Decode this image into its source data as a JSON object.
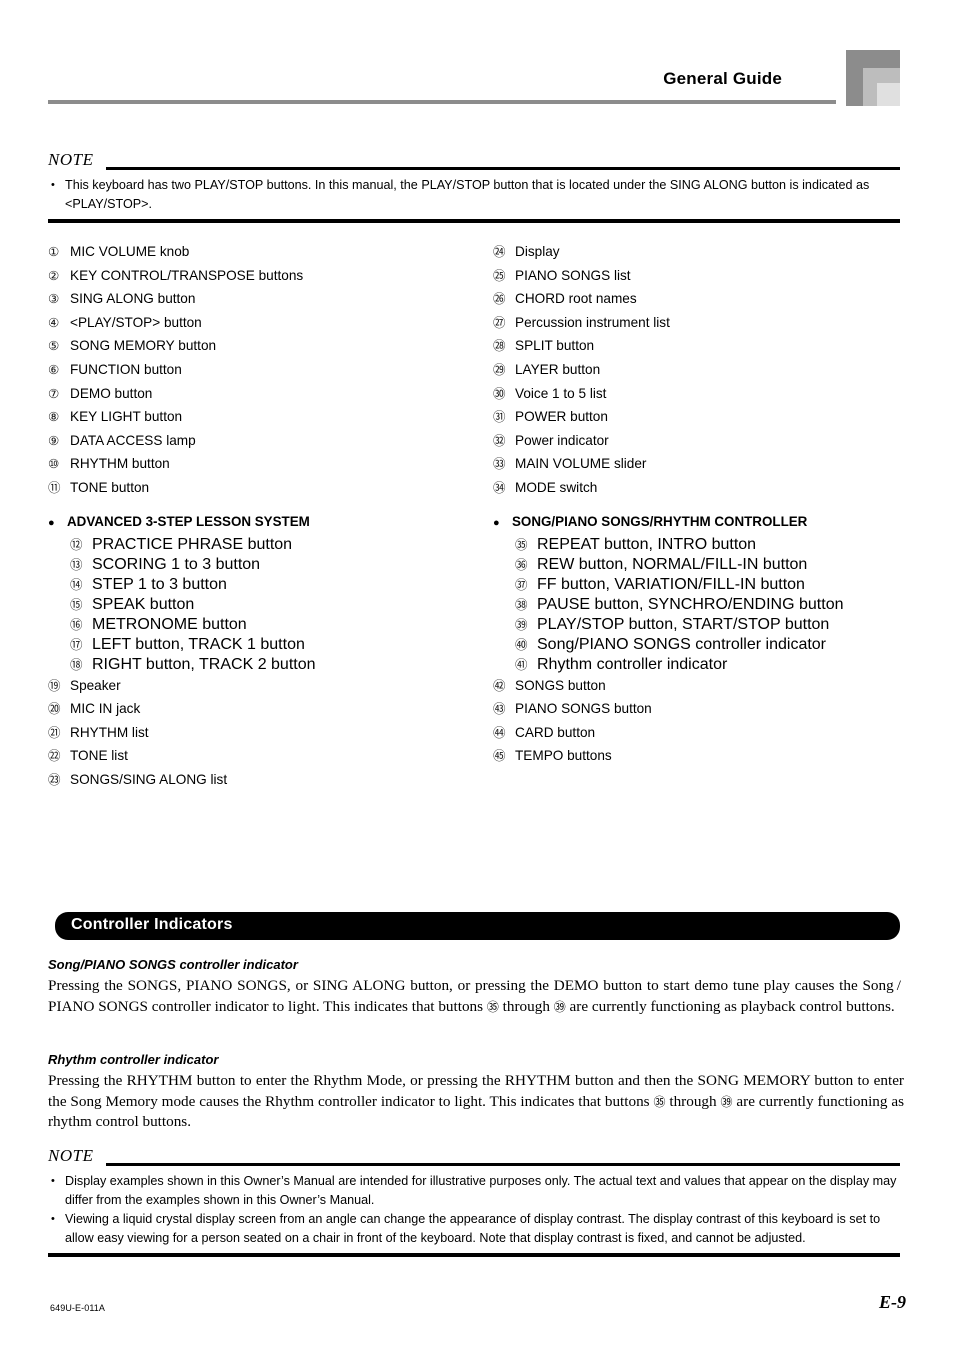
{
  "header": {
    "title": "General Guide",
    "corner_colors": [
      "#8c8c8c",
      "#bdbdbd",
      "#e0e0e0"
    ],
    "rule_color": "#8c8c8c"
  },
  "top_note": {
    "label": "NOTE",
    "items": [
      "This keyboard has two PLAY/STOP buttons. In this manual, the PLAY/STOP button that is located under the SING ALONG button is indicated as <PLAY/STOP>."
    ]
  },
  "reference_list": {
    "left_column": {
      "items_before": [
        {
          "num": "①",
          "text": "MIC VOLUME knob"
        },
        {
          "num": "②",
          "text": "KEY CONTROL/TRANSPOSE buttons"
        },
        {
          "num": "③",
          "text": "SING ALONG button"
        },
        {
          "num": "④",
          "text": "<PLAY/STOP> button"
        },
        {
          "num": "⑤",
          "text": "SONG MEMORY button"
        },
        {
          "num": "⑥",
          "text": "FUNCTION button"
        },
        {
          "num": "⑦",
          "text": "DEMO button"
        },
        {
          "num": "⑧",
          "text": "KEY LIGHT button"
        },
        {
          "num": "⑨",
          "text": "DATA ACCESS lamp"
        },
        {
          "num": "⑩",
          "text": "RHYTHM button"
        },
        {
          "num": "⑪",
          "text": "TONE button"
        }
      ],
      "group": {
        "bullet": "●",
        "title": "ADVANCED 3-STEP LESSON SYSTEM",
        "items": [
          {
            "num": "⑫",
            "text": "PRACTICE PHRASE button"
          },
          {
            "num": "⑬",
            "text": "SCORING 1 to 3 button"
          },
          {
            "num": "⑭",
            "text": "STEP 1 to 3 button"
          },
          {
            "num": "⑮",
            "text": "SPEAK button"
          },
          {
            "num": "⑯",
            "text": "METRONOME button"
          },
          {
            "num": "⑰",
            "text": "LEFT button, TRACK 1 button"
          },
          {
            "num": "⑱",
            "text": "RIGHT button, TRACK 2 button"
          }
        ]
      },
      "items_after": [
        {
          "num": "⑲",
          "text": "Speaker"
        },
        {
          "num": "⑳",
          "text": "MIC IN jack"
        },
        {
          "num": "㉑",
          "text": "RHYTHM list"
        },
        {
          "num": "㉒",
          "text": "TONE list"
        },
        {
          "num": "㉓",
          "text": "SONGS/SING ALONG list"
        }
      ]
    },
    "right_column": {
      "items_before": [
        {
          "num": "㉔",
          "text": "Display"
        },
        {
          "num": "㉕",
          "text": "PIANO SONGS list"
        },
        {
          "num": "㉖",
          "text": "CHORD root names"
        },
        {
          "num": "㉗",
          "text": "Percussion instrument list"
        },
        {
          "num": "㉘",
          "text": "SPLIT button"
        },
        {
          "num": "㉙",
          "text": "LAYER button"
        },
        {
          "num": "㉚",
          "text": "Voice 1 to 5 list"
        },
        {
          "num": "㉛",
          "text": "POWER button"
        },
        {
          "num": "㉜",
          "text": "Power indicator"
        },
        {
          "num": "㉝",
          "text": "MAIN VOLUME slider"
        },
        {
          "num": "㉞",
          "text": "MODE switch"
        }
      ],
      "group": {
        "bullet": "●",
        "title": "SONG/PIANO SONGS/RHYTHM CONTROLLER",
        "items": [
          {
            "num": "㉟",
            "text": "REPEAT button, INTRO button"
          },
          {
            "num": "㊱",
            "text": "REW button, NORMAL/FILL-IN button"
          },
          {
            "num": "㊲",
            "text": "FF button, VARIATION/FILL-IN button"
          },
          {
            "num": "㊳",
            "text": "PAUSE button, SYNCHRO/ENDING button"
          },
          {
            "num": "㊴",
            "text": "PLAY/STOP button, START/STOP button"
          },
          {
            "num": "㊵",
            "text": "Song/PIANO SONGS controller indicator"
          },
          {
            "num": "㊶",
            "text": "Rhythm controller indicator"
          }
        ]
      },
      "items_after": [
        {
          "num": "㊷",
          "text": "SONGS button"
        },
        {
          "num": "㊸",
          "text": "PIANO SONGS button"
        },
        {
          "num": "㊹",
          "text": "CARD button"
        },
        {
          "num": "㊺",
          "text": "TEMPO buttons"
        }
      ]
    }
  },
  "section": {
    "title": "Controller Indicators",
    "banner_bg": "#000000",
    "banner_fg": "#ffffff",
    "subsections": [
      {
        "heading": "Song/PIANO SONGS controller indicator",
        "body_part1": "Pressing the SONGS, PIANO SONGS, or SING ALONG button, or pressing the DEMO button to start demo tune play causes the Song / PIANO SONGS controller indicator to light. This indicates that buttons ",
        "ref_a": "㉟",
        "body_part2": " through ",
        "ref_b": "㊴",
        "body_part3": " are currently functioning as playback control buttons."
      },
      {
        "heading": "Rhythm controller indicator",
        "body_part1": "Pressing the RHYTHM button to enter the Rhythm Mode, or pressing the RHYTHM button and then the SONG MEMORY button to enter the Song Memory mode causes the Rhythm controller indicator to light. This indicates that buttons ",
        "ref_a": "㉟",
        "body_part2": " through ",
        "ref_b": "㊴",
        "body_part3": " are currently functioning as rhythm control buttons."
      }
    ]
  },
  "bottom_note": {
    "label": "NOTE",
    "items": [
      "Display examples shown in this Owner’s Manual are intended for illustrative purposes only. The actual text and values that appear on the display may differ from the examples shown in this Owner’s Manual.",
      "Viewing a liquid crystal display screen from an angle can change the appearance of display contrast. The display contrast of this keyboard is set to allow easy viewing for a person seated on a chair in front of the keyboard. Note that display contrast is fixed, and cannot be adjusted."
    ]
  },
  "footer": {
    "code": "649U-E-011A",
    "page": "E-9"
  }
}
